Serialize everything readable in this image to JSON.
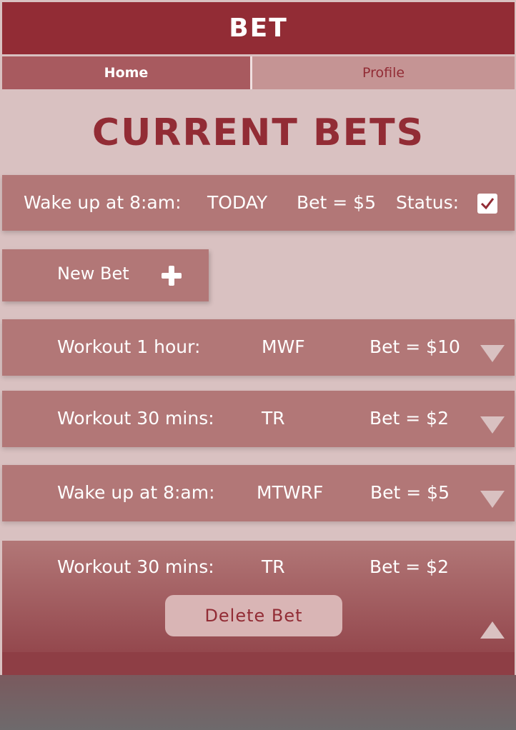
{
  "app": {
    "title": "BET"
  },
  "tabs": [
    {
      "label": "Home",
      "active": true
    },
    {
      "label": "Profile",
      "active": false
    }
  ],
  "section": {
    "title": "CURRENT BETS"
  },
  "today": {
    "goal": "Wake up at 8:am:",
    "when": "TODAY",
    "bet": "Bet = $5",
    "status_label": "Status:",
    "status_checked": true
  },
  "new_bet": {
    "label": "New Bet",
    "icon": "plus-icon"
  },
  "bets": [
    {
      "goal": "Workout 1 hour:",
      "days": "MWF",
      "bet": "Bet = $10",
      "icon": "chevron-down-icon"
    },
    {
      "goal": "Workout 30 mins:",
      "days": "TR",
      "bet": "Bet = $2",
      "icon": "chevron-down-icon"
    },
    {
      "goal": "Wake up at 8:am:",
      "days": "MTWRF",
      "bet": "Bet = $5",
      "icon": "chevron-down-icon"
    }
  ],
  "expanded_bet": {
    "goal": "Workout 30 mins:",
    "days": "TR",
    "bet": "Bet = $2",
    "delete_label": "Delete Bet",
    "icon": "chevron-up-icon"
  },
  "colors": {
    "primary": "#922c35",
    "row": "#b27777",
    "background": "#d9c1c1"
  }
}
